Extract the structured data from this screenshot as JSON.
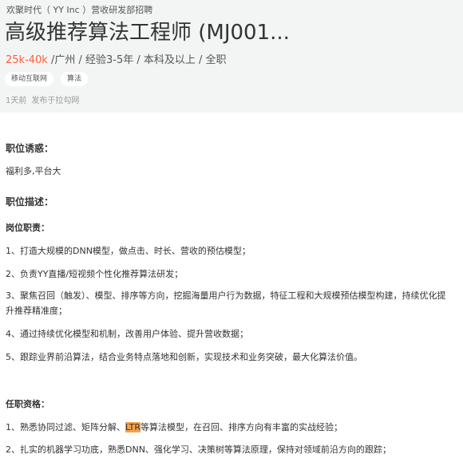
{
  "header": {
    "company": "欢聚时代（ YY Inc ）营收研发部招聘",
    "title": "高级推荐算法工程师 (MJ001...",
    "salary": "25k-40k",
    "meta": " /广州 / 经验3-5年 / 本科及以上 / 全职",
    "tags": [
      "移动互联网",
      "算法"
    ],
    "posted_ago": "1天前",
    "posted_source": "发布于拉勾网"
  },
  "sections": {
    "perks_heading": "职位诱惑：",
    "perks_text": "福利多,平台大",
    "desc_heading": "职位描述：",
    "duties_heading": "岗位职责：",
    "duties": [
      "1、打造大规模的DNN模型，做点击、时长、营收的预估模型；",
      "2、负责YY直播/短视频个性化推荐算法研发；",
      "3、聚焦召回（触发）、模型、排序等方向，挖掘海量用户行为数据，特征工程和大规模预估模型构建，持续优化提升推荐精准度；",
      "4、通过持续优化模型和机制，改善用户体验、提升营收数据；",
      "5、跟踪业界前沿算法，结合业务特点落地和创新，实现技术和业务突破，最大化算法价值。"
    ],
    "req_heading": "任职资格：",
    "req1_before": "1、熟悉协同过滤、矩阵分解、",
    "req1_highlight": "LTR",
    "req1_after": "等算法模型，在召回、排序方向有丰富的实战经验；",
    "req2": "2、扎实的机器学习功底，熟悉DNN、强化学习、决策树等算法原理，保持对领域前沿方向的跟踪；"
  },
  "colors": {
    "header_bg": "#f2f5f4",
    "salary": "#fd5f39",
    "highlight": "#f7a24a"
  }
}
